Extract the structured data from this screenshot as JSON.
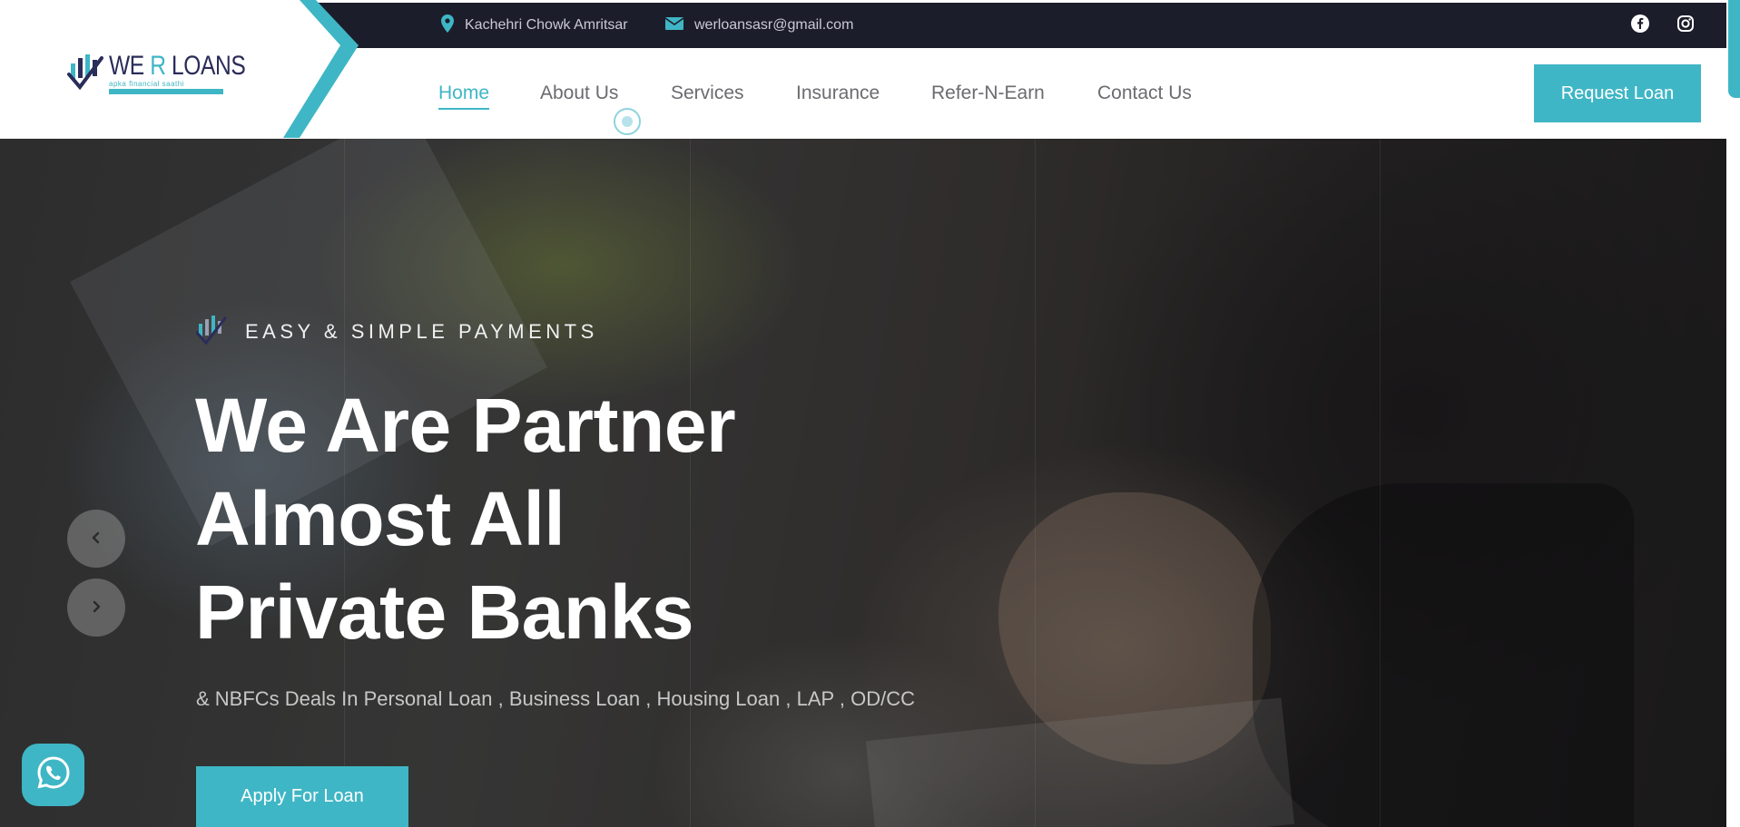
{
  "brand": {
    "logo_prefix": "WE ",
    "logo_r": "R",
    "logo_suffix": " LOANS",
    "tagline": "apka financial saathi"
  },
  "topbar": {
    "location": "Kachehri Chowk Amritsar",
    "email": "werloansasr@gmail.com",
    "social": [
      "facebook-icon",
      "instagram-icon"
    ]
  },
  "nav": {
    "items": [
      {
        "label": "Home",
        "active": true
      },
      {
        "label": "About Us",
        "active": false
      },
      {
        "label": "Services",
        "active": false
      },
      {
        "label": "Insurance",
        "active": false
      },
      {
        "label": "Refer-N-Earn",
        "active": false
      },
      {
        "label": "Contact Us",
        "active": false
      }
    ],
    "cta": "Request Loan"
  },
  "hero": {
    "eyebrow": "EASY & SIMPLE PAYMENTS",
    "headline": [
      "We Are Partner",
      "Almost All",
      "Private Banks"
    ],
    "subline": "& NBFCs Deals In Personal Loan , Business Loan , Housing Loan , LAP , OD/CC",
    "cta": "Apply For Loan"
  },
  "colors": {
    "accent": "#3fb6c5",
    "topbar": "#1c1d2b",
    "brand_navy": "#2a2c59"
  },
  "icons": {
    "location": "map-pin-icon",
    "email": "envelope-icon",
    "prev": "chevron-left-icon",
    "next": "chevron-right-icon",
    "chat": "whatsapp-icon"
  }
}
